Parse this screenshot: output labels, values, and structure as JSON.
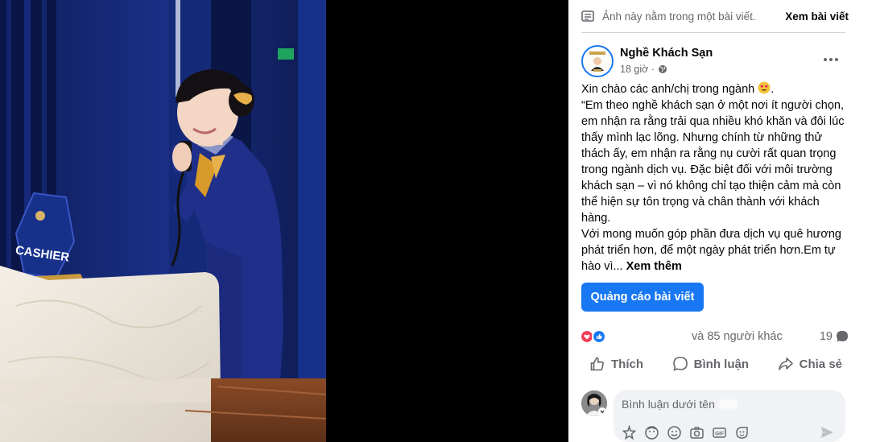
{
  "notice": {
    "text": "Ảnh này nằm trong một bài viết.",
    "see_post": "Xem bài viết"
  },
  "post": {
    "page_name": "Nghề Khách Sạn",
    "time": "18 giờ ·",
    "greeting": "Xin chào các anh/chị trong ngành",
    "body_1": "“Em theo nghề khách sạn ở một nơi ít người chọn, em nhận ra rằng trải qua nhiều khó khăn và đôi lúc thấy mình lạc lõng. Nhưng chính từ những thử thách ấy, em nhận ra rằng nụ cười rất quan trọng trong ngành dịch vụ. Đặc biệt đối với môi trường khách sạn – vì nó không chỉ tạo thiện cảm mà còn thể hiện sự tôn trọng và chân thành với khách hàng.",
    "body_2": "Với mong muốn góp phần đưa dịch vụ quê hương phát triển hơn, để một ngày phát triển hơn.Em tự hào vì...",
    "see_more": "Xem thêm",
    "boost_label": "Quảng cáo bài viết"
  },
  "reactions": {
    "others_text": "và 85 người khác",
    "comment_count": "19"
  },
  "actions": {
    "like": "Thích",
    "comment": "Bình luận",
    "share": "Chia sẻ"
  },
  "comment_box": {
    "placeholder": "Bình luận dưới tên"
  },
  "photo": {
    "sign_text": "CASHIER"
  },
  "colors": {
    "accent": "#1877f2",
    "uniform": "#1f2f8a",
    "gold_scarf": "#d89b2b"
  }
}
